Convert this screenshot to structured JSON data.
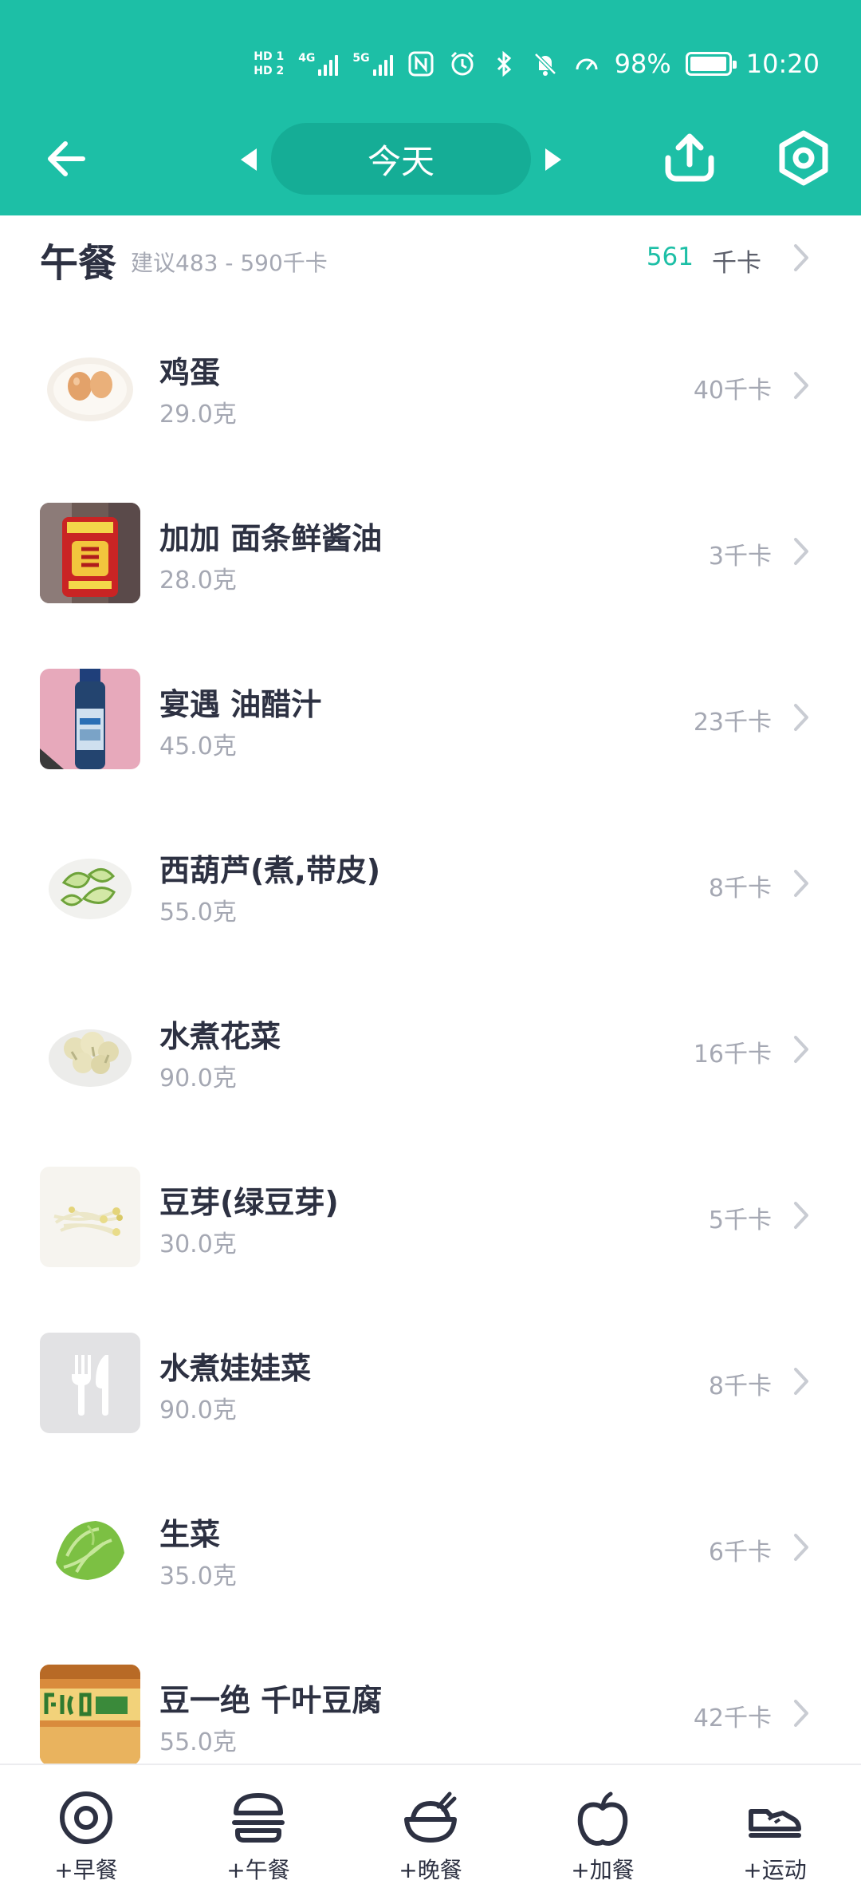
{
  "status_bar": {
    "hd1": "HD 1",
    "hd2": "HD 2",
    "net1": "4G",
    "net2": "5G",
    "battery": "98%",
    "time": "10:20",
    "battery_level": 0.98
  },
  "nav": {
    "date_label": "今天"
  },
  "meal_header": {
    "title": "午餐",
    "suggestion": "建议483 - 590千卡",
    "kcal_total": "561",
    "kcal_unit": "千卡"
  },
  "foods": [
    {
      "name": "鸡蛋",
      "weight": "29.0克",
      "kcal": "40千卡",
      "icon": "egg-image"
    },
    {
      "name": "加加 面条鲜酱油",
      "weight": "28.0克",
      "kcal": "3千卡",
      "icon": "soy-sauce-bottle-image"
    },
    {
      "name": "宴遇 油醋汁",
      "weight": "45.0克",
      "kcal": "23千卡",
      "icon": "vinegar-dressing-bottle-image"
    },
    {
      "name": "西葫芦(煮,带皮)",
      "weight": "55.0克",
      "kcal": "8千卡",
      "icon": "zucchini-image"
    },
    {
      "name": "水煮花菜",
      "weight": "90.0克",
      "kcal": "16千卡",
      "icon": "cauliflower-image"
    },
    {
      "name": "豆芽(绿豆芽)",
      "weight": "30.0克",
      "kcal": "5千卡",
      "icon": "bean-sprout-image"
    },
    {
      "name": "水煮娃娃菜",
      "weight": "90.0克",
      "kcal": "8千卡",
      "icon": "fork-knife-placeholder-icon"
    },
    {
      "name": "生菜",
      "weight": "35.0克",
      "kcal": "6千卡",
      "icon": "lettuce-image"
    },
    {
      "name": "豆一绝 千叶豆腐",
      "weight": "55.0克",
      "kcal": "42千卡",
      "icon": "tofu-package-image"
    }
  ],
  "bottom_nav": [
    {
      "label": "+早餐",
      "icon": "fried-egg-icon"
    },
    {
      "label": "+午餐",
      "icon": "burger-icon"
    },
    {
      "label": "+晚餐",
      "icon": "rice-bowl-icon"
    },
    {
      "label": "+加餐",
      "icon": "apple-icon"
    },
    {
      "label": "+运动",
      "icon": "sneaker-icon"
    }
  ],
  "colors": {
    "accent": "#1dbfa6",
    "pill": "#15ad96",
    "text_dark": "#2d3142",
    "text_muted": "#a5a8b3"
  }
}
